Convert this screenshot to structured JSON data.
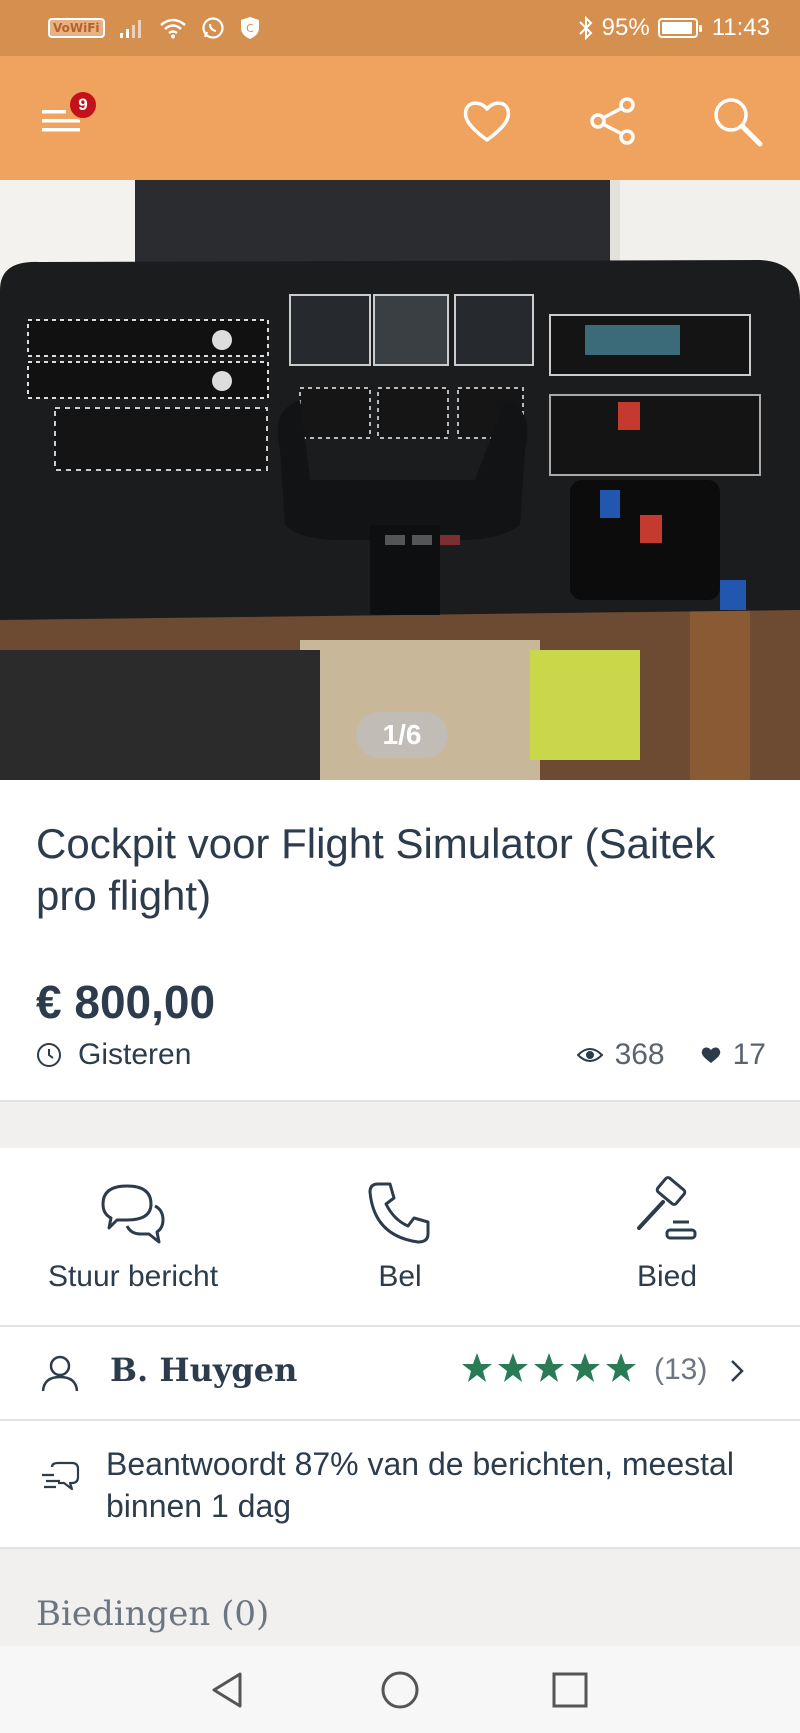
{
  "status_bar": {
    "vowifi": "VoWiFi",
    "battery_percent": "95%",
    "battery_level": 0.95,
    "time": "11:43"
  },
  "app_bar": {
    "menu_badge": "9",
    "icons": [
      "menu-icon",
      "heart-icon",
      "share-icon",
      "search-icon"
    ],
    "accent_color": "#f0a35e"
  },
  "gallery": {
    "counter": "1/6"
  },
  "listing": {
    "title": "Cockpit voor Flight Simulator (Saitek pro flight)",
    "price": "€ 800,00",
    "date": "Gisteren",
    "views": "368",
    "favorites": "17"
  },
  "actions": [
    {
      "label": "Stuur bericht",
      "icon": "chat-icon"
    },
    {
      "label": "Bel",
      "icon": "phone-icon"
    },
    {
      "label": "Bied",
      "icon": "gavel-icon"
    }
  ],
  "seller": {
    "name": "B. Huygen",
    "rating": 5,
    "reviews": "(13)",
    "star_color": "#2a7a55"
  },
  "response": {
    "text": "Beantwoordt 87% van de berichten, meestal binnen 1 dag"
  },
  "bids": {
    "label": "Biedingen (0)"
  }
}
